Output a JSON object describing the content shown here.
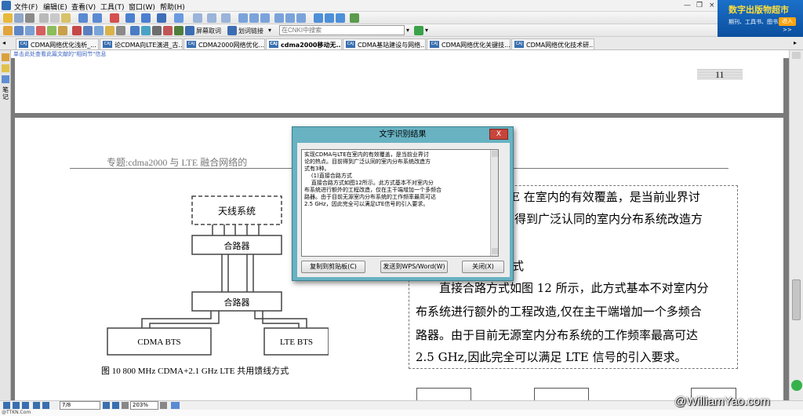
{
  "menu": {
    "file": "文件(F)",
    "edit": "编辑(E)",
    "view": "查看(V)",
    "tools": "工具(T)",
    "window": "窗口(W)",
    "help": "帮助(H)"
  },
  "window_controls": {
    "minimize": "—",
    "restore": "❐",
    "close": "×"
  },
  "toolbar": {
    "screen_word": "屏幕取词",
    "mark_link": "划词链接",
    "cnki_search_placeholder": "在CNKI中搜索"
  },
  "banner": {
    "title": "数字出版物超市",
    "subtitle": "期刊、工具书、图书...",
    "enter": "进入>>"
  },
  "tabs": [
    "CDMA网络优化浅析_...",
    "论CDMA向LTE演进_古...",
    "CDMA2000网络优化...",
    "cdma2000移动无...",
    "CDMA基站建设与网络...",
    "CDMA网络优化关键技...",
    "CDMA网络优化技术研..."
  ],
  "tab_icon_text": "CAJ",
  "link_hint": "单击此处查看此篇文献的\"相同节\"信息",
  "left_tools": {
    "note": "笔记"
  },
  "document": {
    "page_number": "11",
    "header": "专题:cdma2000 与 LTE 融合网络的",
    "diagram": {
      "antenna": "天线系统",
      "combiner_top": "合路器",
      "combiner_bottom": "合路器",
      "cdma_bts": "CDMA BTS",
      "lte_bts": "LTE BTS"
    },
    "caption": "图 10   800 MHz CDMA+2.1 GHz LTE 共用馈线方式",
    "body": [
      "TE 在室内的有效覆盖，是当前业界讨",
      "得到广泛认同的室内分布系统改造方",
      "方式",
      "直接合路方式如图 12 所示，此方式基本不对室内分",
      "布系统进行额外的工程改造,仅在主干端增加一个多频合",
      "路器。由于目前无源室内分布系统的工作频率最高可达",
      "2.5 GHz,因此完全可以满足 LTE 信号的引入要求。"
    ]
  },
  "dialog": {
    "title": "文字识别结果",
    "close": "X",
    "text": "实现CDMA与LTE在室内的有效覆盖，是当前业界讨\n论的热点。目前得到广泛认同的室内分布系统改造方\n式有3种。\n    (1)直接合路方式\n    直接合路方式如图12所示。此方式基本不对室内分\n布系统进行额外的工程改造，仅在主干端增加一个多频合\n路器。由于目前无源室内分布系统的工作频率最高可达\n2.5 GHz，因此完全可以满足LTE信号的引入要求。",
    "copy_button": "复制到剪贴板(C)",
    "send_button": "发送到WPS/Word(W)",
    "close_button": "关闭(X)"
  },
  "status": {
    "page": "7/8",
    "zoom": "203%"
  },
  "bottom_strip": "@TTKN.Com",
  "watermark": "@WilliamYao.com"
}
